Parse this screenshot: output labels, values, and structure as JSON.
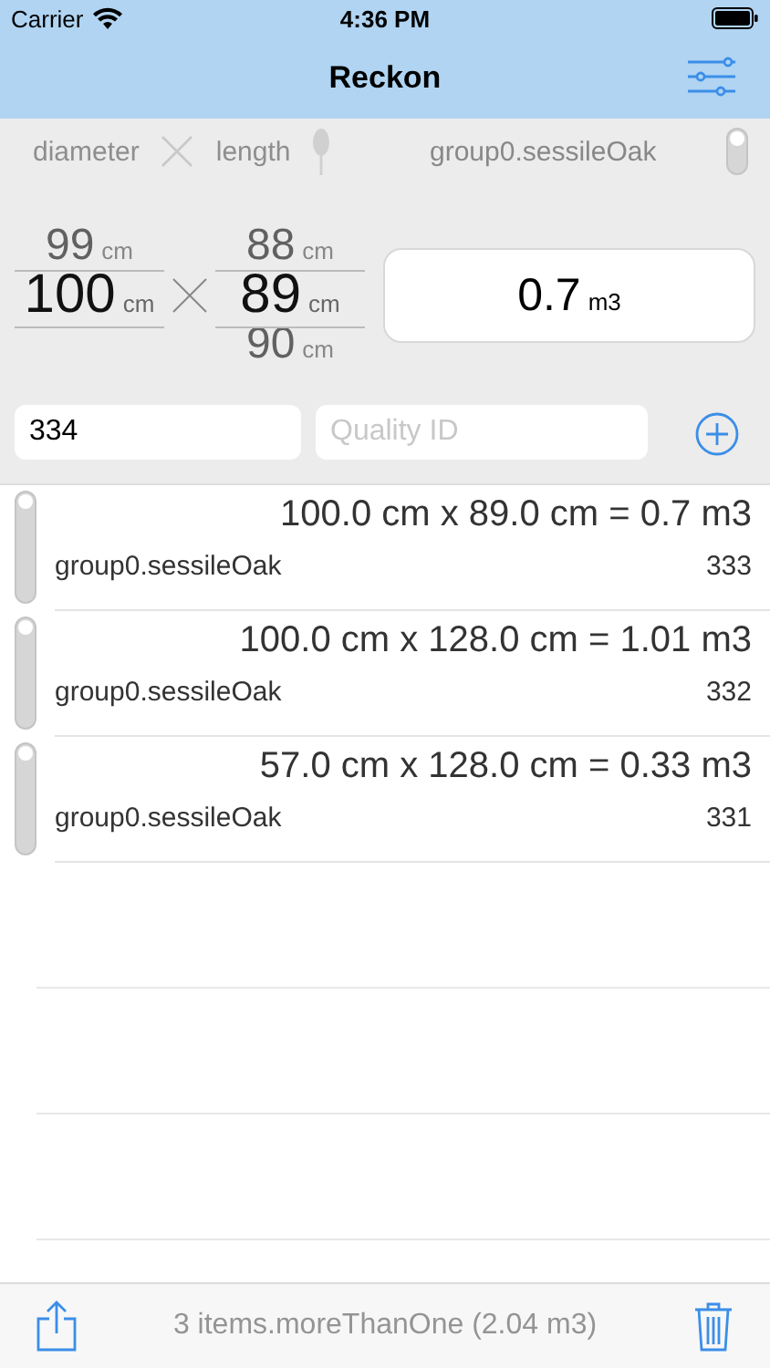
{
  "status_bar": {
    "carrier": "Carrier",
    "time": "4:36 PM"
  },
  "nav": {
    "title": "Reckon"
  },
  "filter": {
    "first": "diameter",
    "second": "length",
    "group": "group0.sessileOak",
    "on": false
  },
  "pickers": [
    {
      "items": [
        {
          "value": "99",
          "unit": "cm",
          "selected": false
        },
        {
          "value": "100",
          "unit": "cm",
          "selected": true
        }
      ]
    },
    {
      "items": [
        {
          "value": "88",
          "unit": "cm",
          "selected": false
        },
        {
          "value": "89",
          "unit": "cm",
          "selected": true
        },
        {
          "value": "90",
          "unit": "cm",
          "selected": false
        }
      ]
    }
  ],
  "result": {
    "value": "0.7",
    "unit": "m3"
  },
  "inputs": {
    "number": "334",
    "quality_placeholder": "Quality ID"
  },
  "rows": [
    {
      "formula": "100.0 cm x 89.0 cm = 0.7 m3",
      "group": "group0.sessileOak",
      "id": "333",
      "on": false
    },
    {
      "formula": "100.0 cm x 128.0 cm = 1.01 m3",
      "group": "group0.sessileOak",
      "id": "332",
      "on": false
    },
    {
      "formula": "57.0 cm x 128.0 cm = 0.33 m3",
      "group": "group0.sessileOak",
      "id": "331",
      "on": false
    }
  ],
  "toolbar": {
    "summary": "3 items.moreThanOne (2.04 m3)"
  }
}
